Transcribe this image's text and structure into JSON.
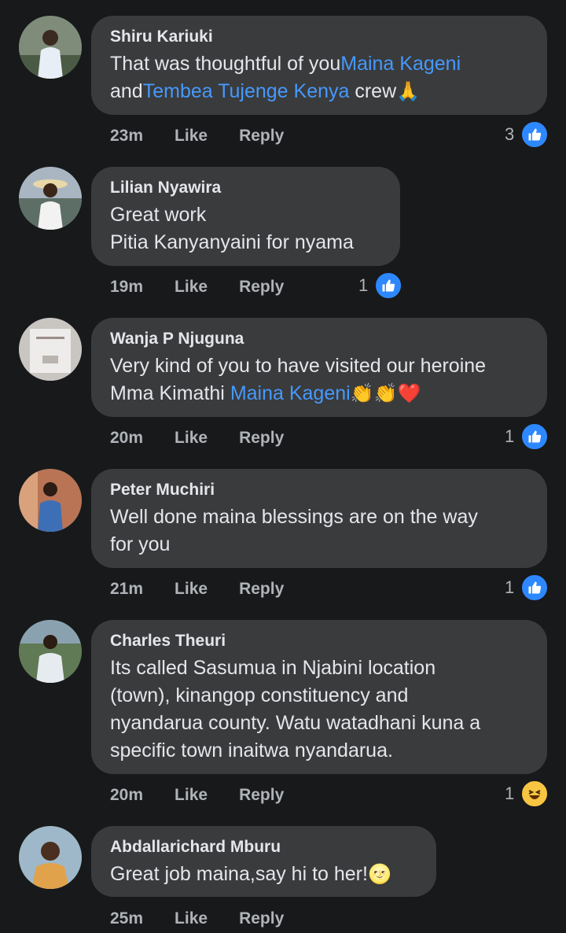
{
  "comments": [
    {
      "author": "Shiru Kariuki",
      "text_parts": [
        "That was thoughtful of you",
        "Maina Kageni",
        "\nand",
        "Tembea Tujenge Kenya",
        " crew",
        "🙏"
      ],
      "time": "23m",
      "like_label": "Like",
      "reply_label": "Reply",
      "reaction_count": "3",
      "reaction_icon": "like-icon"
    },
    {
      "author": "Lilian Nyawira",
      "text_parts": [
        "Great work\nPitia Kanyanyaini for nyama"
      ],
      "time": "19m",
      "like_label": "Like",
      "reply_label": "Reply",
      "reaction_count": "1",
      "reaction_icon": "like-icon"
    },
    {
      "author": "Wanja P Njuguna",
      "text_parts": [
        "Very kind of you to have visited our heroine\nMma Kimathi ",
        "Maina Kageni",
        "👏👏❤️"
      ],
      "time": "20m",
      "like_label": "Like",
      "reply_label": "Reply",
      "reaction_count": "1",
      "reaction_icon": "like-icon"
    },
    {
      "author": "Peter Muchiri",
      "text_parts": [
        "Well done maina blessings are on the way\nfor you"
      ],
      "time": "21m",
      "like_label": "Like",
      "reply_label": "Reply",
      "reaction_count": "1",
      "reaction_icon": "like-icon"
    },
    {
      "author": "Charles Theuri",
      "text_parts": [
        "Its called Sasumua in Njabini location\n(town), kinangop constituency and\nnyandarua county. Watu watadhani kuna a\nspecific town inaitwa nyandarua."
      ],
      "time": "20m",
      "like_label": "Like",
      "reply_label": "Reply",
      "reaction_count": "1",
      "reaction_icon": "haha-icon"
    },
    {
      "author": "Abdallarichard Mburu",
      "text_parts": [
        "Great job maina,say hi to her!",
        "🌝"
      ],
      "time": "25m",
      "like_label": "Like",
      "reply_label": "Reply",
      "reaction_count": "",
      "reaction_icon": ""
    }
  ],
  "colors": {
    "background": "#18191a",
    "bubble": "#3a3b3c",
    "mention": "#4599ff",
    "like_blue": "#2d88ff",
    "meta": "#b0b3b8"
  }
}
